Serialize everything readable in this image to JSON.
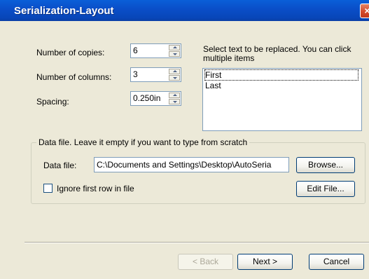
{
  "window": {
    "title": "Serialization-Layout",
    "close_glyph": "×"
  },
  "fields": {
    "copies_label": "Number of copies:",
    "copies_value": "6",
    "columns_label": "Number of columns:",
    "columns_value": "3",
    "spacing_label": "Spacing:",
    "spacing_value": "0.250in"
  },
  "replace": {
    "instruction": "Select text to be replaced. You can click multiple items",
    "items": [
      "First",
      "Last"
    ]
  },
  "datafile": {
    "group_title": "Data file. Leave it empty if you want to type from scratch",
    "label": "Data file:",
    "value": "C:\\Documents and Settings\\Desktop\\AutoSeria",
    "browse_label": "Browse...",
    "ignore_first_row_label": "Ignore first row in file",
    "ignore_first_row_checked": false,
    "edit_file_label": "Edit File..."
  },
  "footer": {
    "back_label": "< Back",
    "next_label": "Next >",
    "cancel_label": "Cancel"
  }
}
